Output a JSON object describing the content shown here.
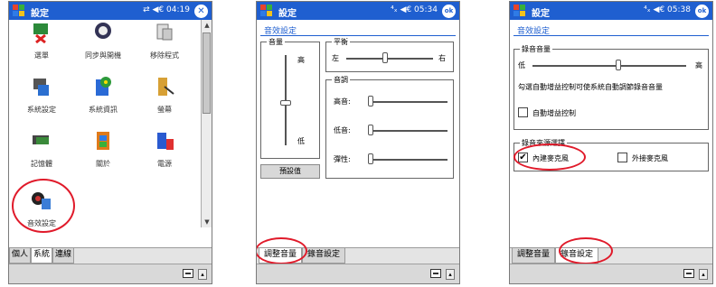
{
  "screen1": {
    "title": "設定",
    "status": "⇄ ◀€ 04:19",
    "close": "✕",
    "icons": [
      {
        "label": "選單",
        "icon": "menu-icon"
      },
      {
        "label": "同步與開機",
        "icon": "sync-icon"
      },
      {
        "label": "移除程式",
        "icon": "remove-programs-icon"
      },
      {
        "label": "系統設定",
        "icon": "system-icon"
      },
      {
        "label": "系統資訊",
        "icon": "info-icon"
      },
      {
        "label": "螢幕",
        "icon": "screen-icon"
      },
      {
        "label": "記憶體",
        "icon": "memory-icon"
      },
      {
        "label": "關於",
        "icon": "about-icon"
      },
      {
        "label": "電源",
        "icon": "power-icon"
      },
      {
        "label": "音效設定",
        "icon": "sound-icon"
      }
    ],
    "tabs": [
      "個人",
      "系統",
      "連線"
    ],
    "active_tab": "系統"
  },
  "screen2": {
    "title": "設定",
    "status": "⁴ₓ ◀€ 05:34",
    "ok": "ok",
    "page_header": "音效設定",
    "volume_group": {
      "title": "音量",
      "high": "高",
      "low": "低"
    },
    "balance_group": {
      "title": "平衡",
      "left": "左",
      "right": "右"
    },
    "tone_group": {
      "title": "音調",
      "items": [
        "高音:",
        "低音:",
        "彈性:"
      ]
    },
    "default_button": "預設值",
    "tabs": [
      "調整音量",
      "錄音設定"
    ],
    "active_tab": "調整音量"
  },
  "screen3": {
    "title": "設定",
    "status": "⁴ₓ ◀€ 05:38",
    "ok": "ok",
    "page_header": "音效設定",
    "record_group": {
      "title": "錄音音量",
      "low": "低",
      "high": "高"
    },
    "description": "勾選自動增益控制可使系統自動調節錄音音量",
    "auto_gain_label": "自動增益控制",
    "mic_group_title": "錄音來源選擇",
    "internal_mic_label": "內建麥克風",
    "external_mic_label": "外接麥克風",
    "tabs": [
      "調整音量",
      "錄音設定"
    ],
    "active_tab": "錄音設定"
  },
  "colors": {
    "titlebar": "#1f5fd0",
    "highlight": "#e01a2a"
  }
}
